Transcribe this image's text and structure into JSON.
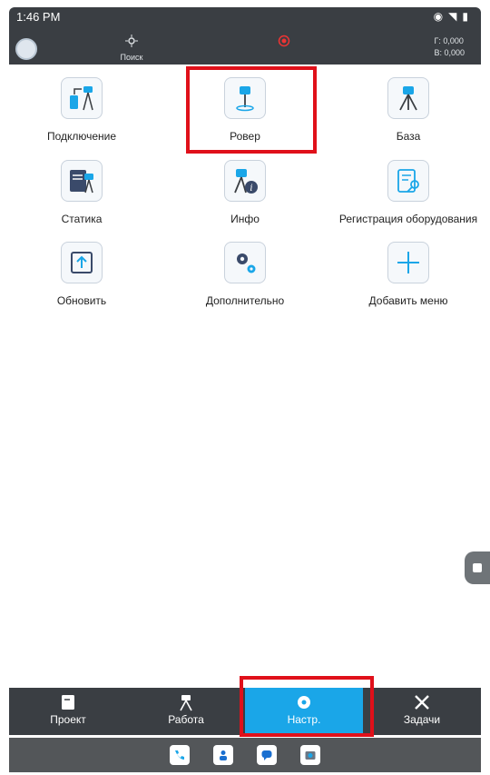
{
  "status": {
    "time": "1:46 PM"
  },
  "top": {
    "search_label": "Поиск",
    "coord_h": "Г: 0,000",
    "coord_v": "В: 0,000"
  },
  "tiles": [
    {
      "label": "Подключение"
    },
    {
      "label": "Ровер"
    },
    {
      "label": "База"
    },
    {
      "label": "Статика"
    },
    {
      "label": "Инфо"
    },
    {
      "label": "Регистрация оборудования"
    },
    {
      "label": "Обновить"
    },
    {
      "label": "Дополнительно"
    },
    {
      "label": "Добавить меню"
    }
  ],
  "tabs": [
    {
      "label": "Проект"
    },
    {
      "label": "Работа"
    },
    {
      "label": "Настр."
    },
    {
      "label": "Задачи"
    }
  ],
  "colors": {
    "accent": "#1aa6e8",
    "bar": "#3a3e43",
    "highlight": "#e0101a"
  }
}
